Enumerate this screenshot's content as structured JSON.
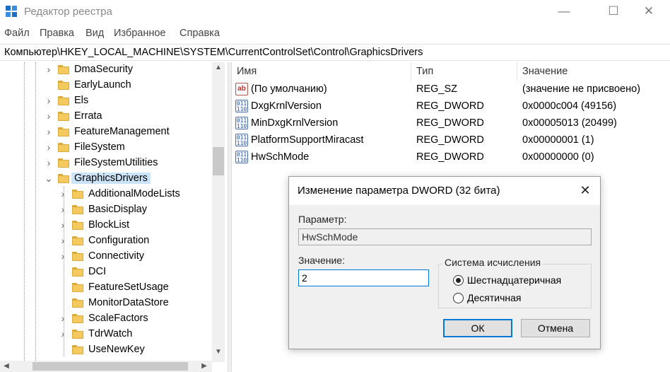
{
  "window": {
    "title": "Редактор реестра",
    "minimize_glyph": "—",
    "maximize_glyph": "☐",
    "close_glyph": "✕"
  },
  "menu": [
    "Файл",
    "Правка",
    "Вид",
    "Избранное",
    "Справка"
  ],
  "address": "Компьютер\\HKEY_LOCAL_MACHINE\\SYSTEM\\CurrentControlSet\\Control\\GraphicsDrivers",
  "tree": {
    "items": [
      {
        "label": "DmaSecurity",
        "chevron": "›"
      },
      {
        "label": "EarlyLaunch",
        "chevron": ""
      },
      {
        "label": "Els",
        "chevron": "›"
      },
      {
        "label": "Errata",
        "chevron": "›"
      },
      {
        "label": "FeatureManagement",
        "chevron": "›"
      },
      {
        "label": "FileSystem",
        "chevron": "›"
      },
      {
        "label": "FileSystemUtilities",
        "chevron": "›"
      },
      {
        "label": "GraphicsDrivers",
        "chevron": "⌄",
        "selected": true
      },
      {
        "label": "AdditionalModeLists",
        "chevron": "›"
      },
      {
        "label": "BasicDisplay",
        "chevron": "›"
      },
      {
        "label": "BlockList",
        "chevron": "›"
      },
      {
        "label": "Configuration",
        "chevron": "›"
      },
      {
        "label": "Connectivity",
        "chevron": "›"
      },
      {
        "label": "DCI",
        "chevron": ""
      },
      {
        "label": "FeatureSetUsage",
        "chevron": ""
      },
      {
        "label": "MonitorDataStore",
        "chevron": ""
      },
      {
        "label": "ScaleFactors",
        "chevron": "›"
      },
      {
        "label": "TdrWatch",
        "chevron": "›"
      },
      {
        "label": "UseNewKey",
        "chevron": ""
      }
    ]
  },
  "list": {
    "columns": [
      "Имя",
      "Тип",
      "Значение"
    ],
    "rows": [
      {
        "icon": "string-value-icon",
        "icon_text": "ab",
        "name": "(По умолчанию)",
        "type": "REG_SZ",
        "value": "(значение не присвоено)"
      },
      {
        "icon": "binary-value-icon",
        "icon_text": "011\n110",
        "name": "DxgKrnlVersion",
        "type": "REG_DWORD",
        "value": "0x0000c004 (49156)"
      },
      {
        "icon": "binary-value-icon",
        "icon_text": "011\n110",
        "name": "MinDxgKrnlVersion",
        "type": "REG_DWORD",
        "value": "0x00005013 (20499)"
      },
      {
        "icon": "binary-value-icon",
        "icon_text": "011\n110",
        "name": "PlatformSupportMiracast",
        "type": "REG_DWORD",
        "value": "0x00000001 (1)"
      },
      {
        "icon": "binary-value-icon",
        "icon_text": "011\n110",
        "name": "HwSchMode",
        "type": "REG_DWORD",
        "value": "0x00000000 (0)"
      }
    ]
  },
  "dialog": {
    "title": "Изменение параметра DWORD (32 бита)",
    "close_glyph": "✕",
    "param_label": "Параметр:",
    "param_value": "HwSchMode",
    "value_label": "Значение:",
    "value_input": "2",
    "base_group": "Система исчисления",
    "radio_hex": "Шестнадцатеричная",
    "radio_dec": "Десятичная",
    "selected_base": "hex",
    "ok": "ОК",
    "cancel": "Отмена"
  },
  "colors": {
    "accent": "#0078d7",
    "selection": "#cce4f7",
    "folder": "#f4c95d"
  }
}
